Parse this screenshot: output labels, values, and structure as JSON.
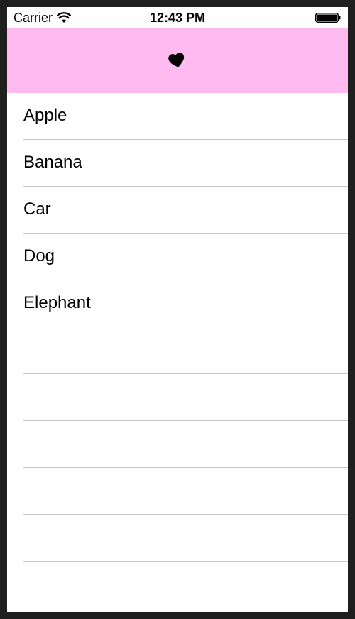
{
  "status_bar": {
    "carrier": "Carrier",
    "time": "12:43 PM",
    "wifi_icon": "wifi-icon",
    "battery_icon": "battery-icon"
  },
  "nav_bar": {
    "background_color": "#ffbaf0",
    "icon": "heart-icon"
  },
  "table": {
    "rows": [
      {
        "label": "Apple"
      },
      {
        "label": "Banana"
      },
      {
        "label": "Car"
      },
      {
        "label": "Dog"
      },
      {
        "label": "Elephant"
      },
      {
        "label": ""
      },
      {
        "label": ""
      },
      {
        "label": ""
      },
      {
        "label": ""
      },
      {
        "label": ""
      },
      {
        "label": ""
      }
    ],
    "separator_color": "#c8c7cc"
  }
}
